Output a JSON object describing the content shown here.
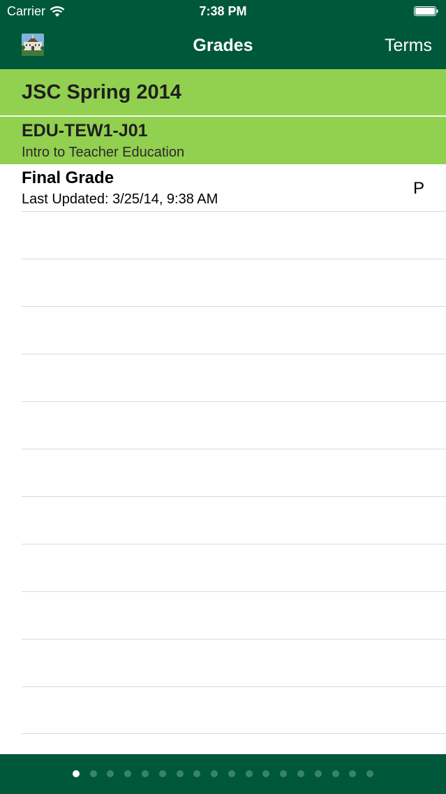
{
  "status_bar": {
    "carrier": "Carrier",
    "time": "7:38 PM"
  },
  "nav": {
    "title": "Grades",
    "right_button": "Terms",
    "left_icon": "campus-building-thumbnail-icon"
  },
  "term": {
    "title": "JSC Spring 2014"
  },
  "course": {
    "code": "EDU-TEW1-J01",
    "name": "Intro to Teacher Education"
  },
  "grades": [
    {
      "label": "Final Grade",
      "updated": "Last Updated: 3/25/14, 9:38 AM",
      "value": "P"
    }
  ],
  "pager": {
    "page_count": 18,
    "current_page": 1
  },
  "colors": {
    "nav_background": "#00583a",
    "section_background": "#92d050",
    "dot_inactive": "#3a8466",
    "dot_active": "#ffffff"
  }
}
